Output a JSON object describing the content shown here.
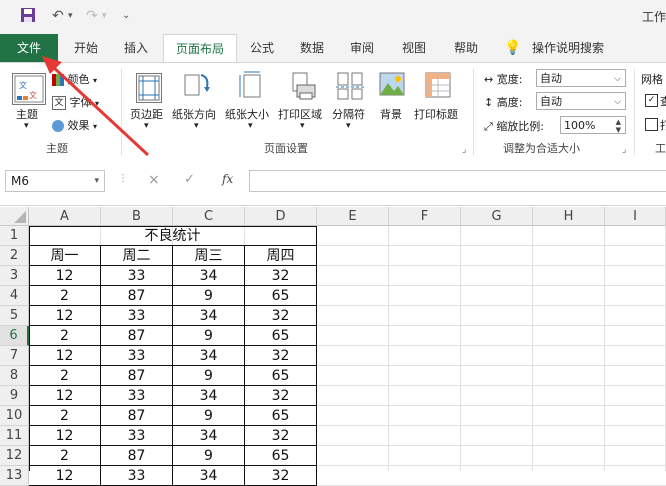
{
  "window": {
    "title": "工作"
  },
  "qat": {
    "save_icon": "save-icon",
    "undo_icon": "undo-icon",
    "redo_icon": "redo-icon",
    "customize_icon": "customize-qat-icon"
  },
  "tabs": [
    {
      "label": "文件"
    },
    {
      "label": "开始"
    },
    {
      "label": "插入"
    },
    {
      "label": "页面布局"
    },
    {
      "label": "公式"
    },
    {
      "label": "数据"
    },
    {
      "label": "审阅"
    },
    {
      "label": "视图"
    },
    {
      "label": "帮助"
    },
    {
      "label": "操作说明搜索"
    }
  ],
  "ribbon": {
    "themes": {
      "theme": "主题",
      "colors": "颜色",
      "fonts": "字体",
      "effects": "效果",
      "group": "主题"
    },
    "page_setup": {
      "margins": "页边距",
      "orientation": "纸张方向",
      "size": "纸张大小",
      "print_area": "打印区域",
      "breaks": "分隔符",
      "background": "背景",
      "print_titles": "打印标题",
      "group": "页面设置"
    },
    "scale": {
      "width_label": "宽度:",
      "width_value": "自动",
      "height_label": "高度:",
      "height_value": "自动",
      "scale_label": "缩放比例:",
      "scale_value": "100%",
      "group": "调整为合适大小"
    },
    "sheet_options": {
      "gridlines": "网格",
      "view_mark": "查",
      "print_mark": "打",
      "group": "工"
    }
  },
  "formula_bar": {
    "name_box": "M6",
    "cancel": "×",
    "enter": "✓",
    "fx": "fx"
  },
  "sheet": {
    "columns": [
      "A",
      "B",
      "C",
      "D",
      "E",
      "F",
      "G",
      "H",
      "I"
    ],
    "rows": [
      "1",
      "2",
      "3",
      "4",
      "5",
      "6",
      "7",
      "8",
      "9",
      "10",
      "11",
      "12",
      "13"
    ],
    "selected_row": "6",
    "table_title": "不良统计",
    "headers": [
      "周一",
      "周二",
      "周三",
      "周四"
    ],
    "data": [
      [
        "12",
        "33",
        "34",
        "32"
      ],
      [
        "2",
        "87",
        "9",
        "65"
      ],
      [
        "12",
        "33",
        "34",
        "32"
      ],
      [
        "2",
        "87",
        "9",
        "65"
      ],
      [
        "12",
        "33",
        "34",
        "32"
      ],
      [
        "2",
        "87",
        "9",
        "65"
      ],
      [
        "12",
        "33",
        "34",
        "32"
      ],
      [
        "2",
        "87",
        "9",
        "65"
      ],
      [
        "12",
        "33",
        "34",
        "32"
      ],
      [
        "2",
        "87",
        "9",
        "65"
      ],
      [
        "12",
        "33",
        "34",
        "32"
      ]
    ]
  },
  "colors": {
    "excel_green": "#217346",
    "annotation_red": "#e53935"
  }
}
